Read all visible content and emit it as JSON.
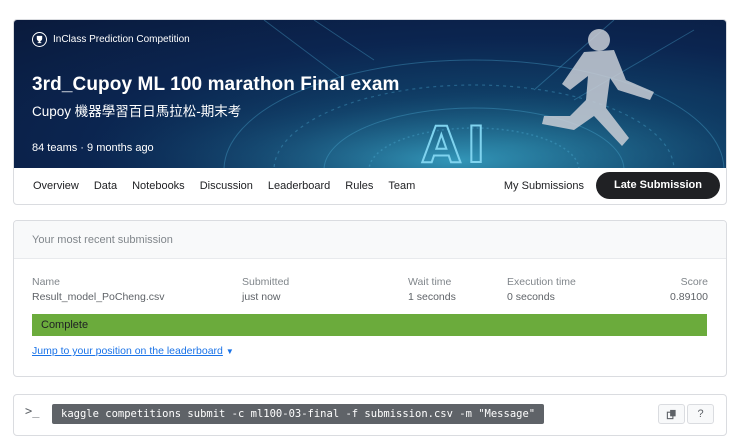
{
  "competition": {
    "type_label": "InClass Prediction Competition",
    "title": "3rd_Cupoy ML 100 marathon Final exam",
    "subtitle": "Cupoy 機器學習百日馬拉松-期末考",
    "meta": "84 teams · 9 months ago",
    "banner_text": "AI"
  },
  "tabs": [
    "Overview",
    "Data",
    "Notebooks",
    "Discussion",
    "Leaderboard",
    "Rules",
    "Team"
  ],
  "tabs_right": {
    "my_submissions": "My Submissions",
    "late_submission": "Late Submission"
  },
  "submission": {
    "header": "Your most recent submission",
    "columns": {
      "name": {
        "label": "Name",
        "value": "Result_model_PoCheng.csv"
      },
      "submitted": {
        "label": "Submitted",
        "value": "just now"
      },
      "wait": {
        "label": "Wait time",
        "value": "1 seconds"
      },
      "execution": {
        "label": "Execution time",
        "value": "0 seconds"
      },
      "score": {
        "label": "Score",
        "value": "0.89100"
      }
    },
    "status": "Complete",
    "status_color": "#6bab3c",
    "jump_link": "Jump to your position on the leaderboard"
  },
  "command": {
    "prompt": ">_",
    "text": "kaggle competitions submit -c ml100-03-final -f submission.csv -m \"Message\"",
    "copy_icon": "copy-icon",
    "help_label": "?"
  }
}
